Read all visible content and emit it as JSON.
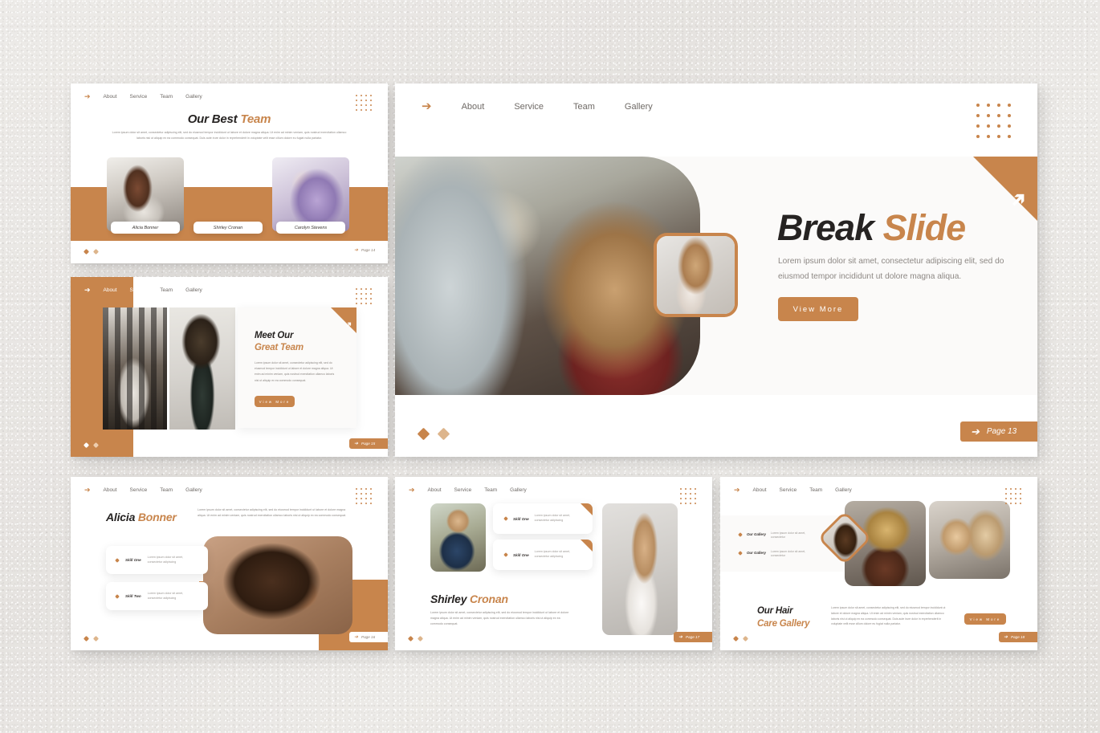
{
  "nav": {
    "arrow_icon": "arrow-right-icon",
    "items": [
      "About",
      "Service",
      "Team",
      "Gallery"
    ]
  },
  "colors": {
    "accent": "#c8854c",
    "accent_light": "#ddb58c",
    "heading": "#262322",
    "body": "#8d8884",
    "slide_bg": "#ffffff",
    "canvas_bg": "#e9e7e4"
  },
  "lorem": {
    "short": "Lorem ipsum dolor sit amet, consectetur adipiscing elit, sed do eiusmod tempor incididunt ut dolore magna aliqua.",
    "medium": "Lorem ipsum dolor sit amet, consectetur adipiscing elit, sed do eiusmod tempor incididunt ut labore et dolore magna aliqua. Ut enim ad minim veniam, quis nostrud exercitation ullamco laboris nisi ut aliquip ex ea commodo consequat.",
    "long": "Lorem ipsum dolor sit amet, consectetur adipiscing elit, sed do eiusmod tempor incididunt ut labore et dolore magna aliqua. Ut enim ad minim veniam, quis nostrud exercitation ullamco laboris nisi ut aliquip ex ea commodo consequat. Duis aute irure dolor in reprehenderit in voluptate velit esse cillum dolore eu fugiat nulla pariatur.",
    "card": "Lorem ipsum dolor sit amet, consectetur adipiscing"
  },
  "slide_team_grid": {
    "title_dark": "Our Best",
    "title_accent": "Team",
    "members": [
      {
        "name": "Alicia Bonner"
      },
      {
        "name": "Shirley Cronan"
      },
      {
        "name": "Carolyn Stevens"
      }
    ],
    "page_label": "Page 14"
  },
  "slide_meet_team": {
    "title_dark": "Meet Our",
    "title_accent": "Great Team",
    "button_label": "View More",
    "page_label": "Page 15"
  },
  "slide_break": {
    "title_dark": "Break",
    "title_accent": "Slide",
    "body": "Lorem ipsum dolor sit amet, consectetur adipiscing elit, sed do eiusmod tempor incididunt ut dolore magna aliqua.",
    "button_label": "View More",
    "page_label": "Page 13"
  },
  "slide_alicia": {
    "title_dark": "Alicia",
    "title_accent": "Bonner",
    "skills": [
      {
        "title": "Skill One",
        "desc": "Lorem ipsum dolor sit amet, consectetur adipiscing"
      },
      {
        "title": "Skill Two",
        "desc": "Lorem ipsum dolor sit amet, consectetur adipiscing"
      }
    ],
    "page_label": "Page 16"
  },
  "slide_shirley": {
    "title_dark": "Shirley",
    "title_accent": "Cronan",
    "skills": [
      {
        "title": "Skill One",
        "desc": "Lorem ipsum dolor sit amet, consectetur adipiscing"
      },
      {
        "title": "Skill One",
        "desc": "Lorem ipsum dolor sit amet, consectetur adipiscing"
      }
    ],
    "page_label": "Page 17"
  },
  "slide_gallery": {
    "title_dark": "Our Hair",
    "title_accent": "Care Gallery",
    "items": [
      {
        "label": "Our Gallery",
        "desc": "Lorem ipsum dolor sit amet, consectetur"
      },
      {
        "label": "Our Gallery",
        "desc": "Lorem ipsum dolor sit amet, consectetur"
      }
    ],
    "button_label": "View More",
    "page_label": "Page 18"
  }
}
